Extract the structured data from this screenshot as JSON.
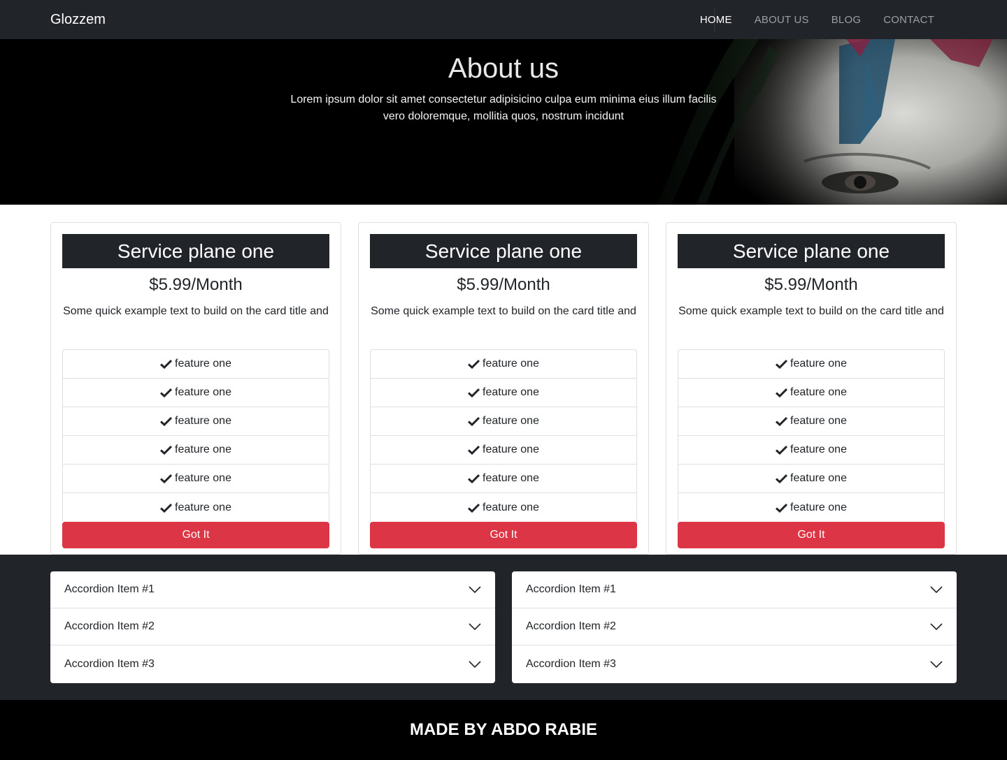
{
  "navbar": {
    "brand": "Glozzem",
    "links": [
      "HOME",
      "ABOUT US",
      "BLOG",
      "CONTACT"
    ],
    "active_index": 0
  },
  "hero": {
    "title": "About us",
    "text": "Lorem ipsum dolor sit amet consectetur adipisicino culpa eum minima eius illum facilis vero doloremque, mollitia quos, nostrum incidunt"
  },
  "plans": [
    {
      "title": "Service plane one",
      "price": "$5.99/Month",
      "text": "Some quick example text to build on the card title and",
      "features": [
        "feature one",
        "feature one",
        "feature one",
        "feature one",
        "feature one",
        "feature one"
      ],
      "button": "Got It"
    },
    {
      "title": "Service plane one",
      "price": "$5.99/Month",
      "text": "Some quick example text to build on the card title and",
      "features": [
        "feature one",
        "feature one",
        "feature one",
        "feature one",
        "feature one",
        "feature one"
      ],
      "button": "Got It"
    },
    {
      "title": "Service plane one",
      "price": "$5.99/Month",
      "text": "Some quick example text to build on the card title and",
      "features": [
        "feature one",
        "feature one",
        "feature one",
        "feature one",
        "feature one",
        "feature one"
      ],
      "button": "Got It"
    }
  ],
  "accordions": [
    {
      "items": [
        "Accordion Item #1",
        "Accordion Item #2",
        "Accordion Item #3"
      ]
    },
    {
      "items": [
        "Accordion Item #1",
        "Accordion Item #2",
        "Accordion Item #3"
      ]
    }
  ],
  "footer": {
    "text": "MADE BY ABDO RABIE"
  },
  "colors": {
    "dark": "#212529",
    "danger": "#dc3545",
    "footer_bg": "#000000"
  },
  "icons": {
    "feature": "check-icon",
    "accordion": "chevron-down-icon"
  }
}
